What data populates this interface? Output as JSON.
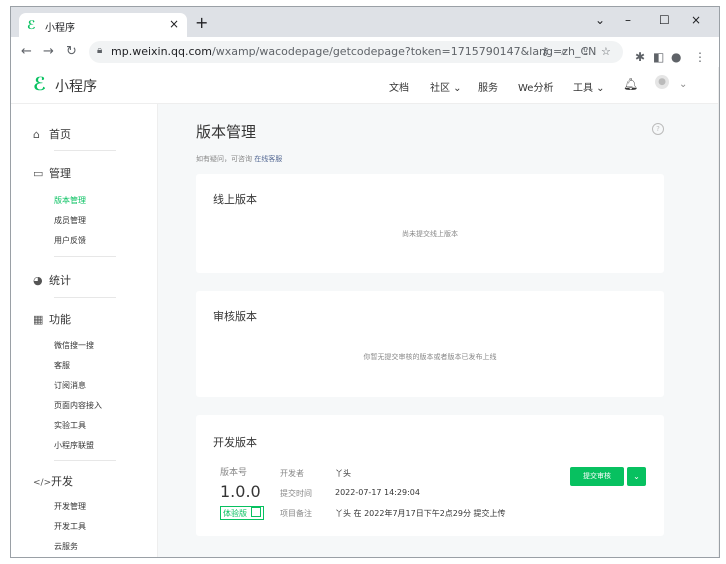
{
  "browser": {
    "tab_title": "小程序",
    "tab_close": "×",
    "new_tab": "+",
    "win_min": "–",
    "win_max": "☐",
    "win_close": "×",
    "win_menu": "⌄",
    "url_host": "mp.weixin.qq.com",
    "url_path": "/wxamp/wacodepage/getcodepage?token=1715790147&lang=zh_CN"
  },
  "header": {
    "logo_text": "小程序",
    "nav": [
      "文档",
      "社区",
      "服务",
      "We分析",
      "工具"
    ]
  },
  "sidebar": {
    "home": "首页",
    "manage": "管理",
    "manage_items": [
      "版本管理",
      "成员管理",
      "用户反馈"
    ],
    "stats": "统计",
    "features": "功能",
    "feature_items": [
      "微信搜一搜",
      "客服",
      "订阅消息",
      "页面内容接入",
      "实验工具",
      "小程序联盟"
    ],
    "dev": "开发",
    "dev_items": [
      "开发管理",
      "开发工具",
      "云服务"
    ]
  },
  "main": {
    "title": "版本管理",
    "help_prefix": "如有疑问，可咨询",
    "help_link": "在线客服",
    "online": {
      "title": "线上版本",
      "empty": "尚未提交线上版本"
    },
    "review": {
      "title": "审核版本",
      "empty": "你暂无提交审核的版本或者版本已发布上线"
    },
    "dev": {
      "title": "开发版本",
      "version_label": "版本号",
      "version": "1.0.0",
      "tag": "体验版",
      "developer_label": "开发者",
      "developer": "丫头",
      "time_label": "提交时间",
      "time": "2022-07-17 14:29:04",
      "note_label": "项目备注",
      "note": "丫头 在 2022年7月17日下午2点29分 提交上传",
      "submit_button": "提交审核",
      "dropdown": "⌄"
    }
  },
  "colors": {
    "accent": "#07c160",
    "link": "#576b95"
  }
}
